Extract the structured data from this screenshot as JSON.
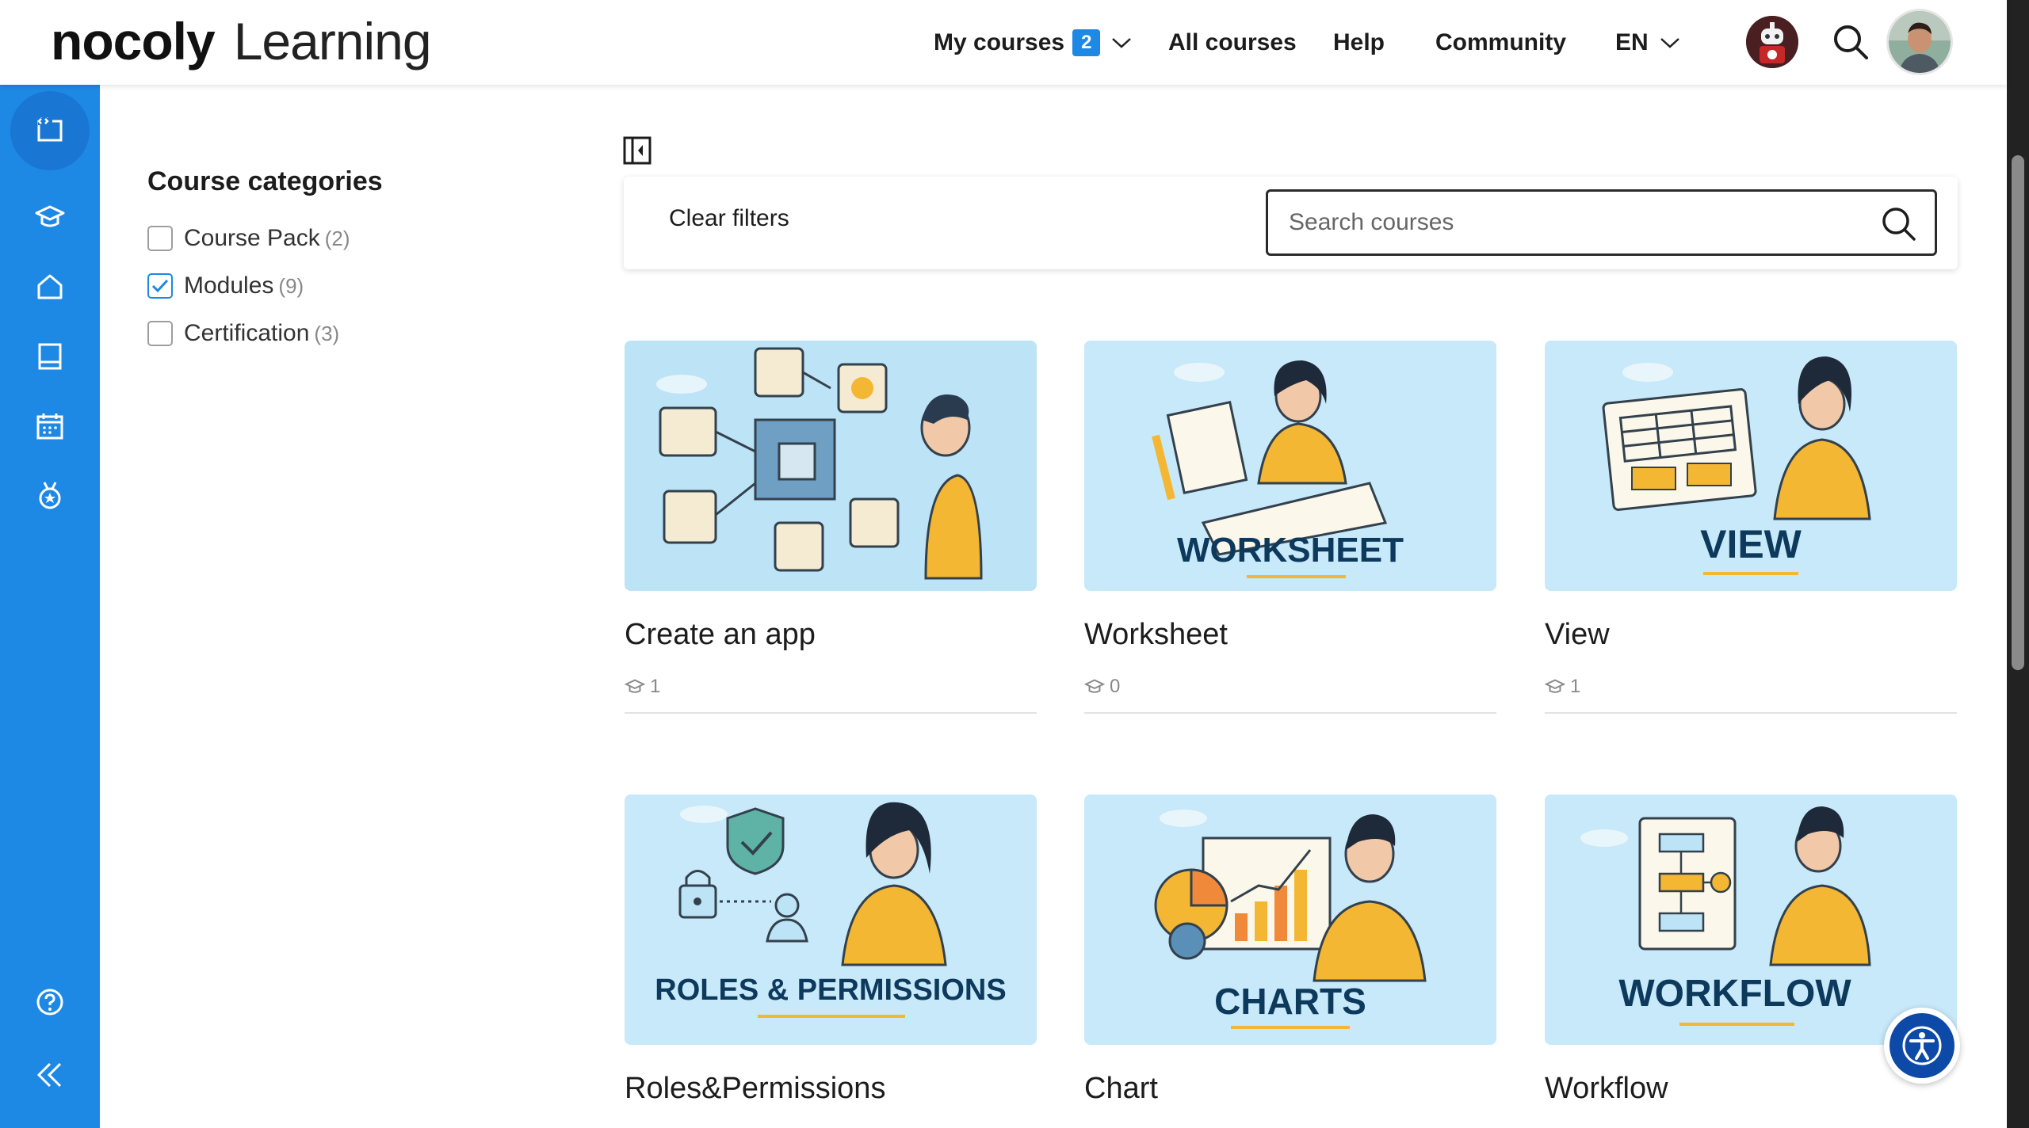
{
  "header": {
    "brand_bold": "nocoly",
    "brand_light": "Learning",
    "nav": {
      "my_courses": "My courses",
      "my_courses_count": "2",
      "all_courses": "All courses",
      "help": "Help",
      "community": "Community",
      "language": "EN"
    }
  },
  "sidebar": {
    "items": [
      "catalog-icon",
      "graduation-cap-icon",
      "home-icon",
      "book-icon",
      "calendar-icon",
      "medal-icon"
    ],
    "bottom": [
      "help-circle-icon",
      "collapse-icon"
    ]
  },
  "filters": {
    "title": "Course categories",
    "categories": [
      {
        "label": "Course Pack",
        "count": "(2)",
        "checked": false
      },
      {
        "label": "Modules",
        "count": "(9)",
        "checked": true
      },
      {
        "label": "Certification",
        "count": "(3)",
        "checked": false
      }
    ]
  },
  "toolbar": {
    "clear_filters": "Clear filters",
    "search_placeholder": "Search courses"
  },
  "courses": [
    {
      "title": "Create an app",
      "students": "1",
      "banner": ""
    },
    {
      "title": "Worksheet",
      "students": "0",
      "banner": "WORKSHEET"
    },
    {
      "title": "View",
      "students": "1",
      "banner": "VIEW"
    },
    {
      "title": "Roles&Permissions",
      "students": "",
      "banner": "ROLES & PERMISSIONS"
    },
    {
      "title": "Chart",
      "students": "",
      "banner": "CHARTS"
    },
    {
      "title": "Workflow",
      "students": "",
      "banner": "WORKFLOW"
    }
  ],
  "colors": {
    "brand_blue": "#1e88e5",
    "banner_text": "#0d3a5c",
    "accent_yellow": "#f4b733",
    "tile_bg": "#bfe6f8"
  }
}
